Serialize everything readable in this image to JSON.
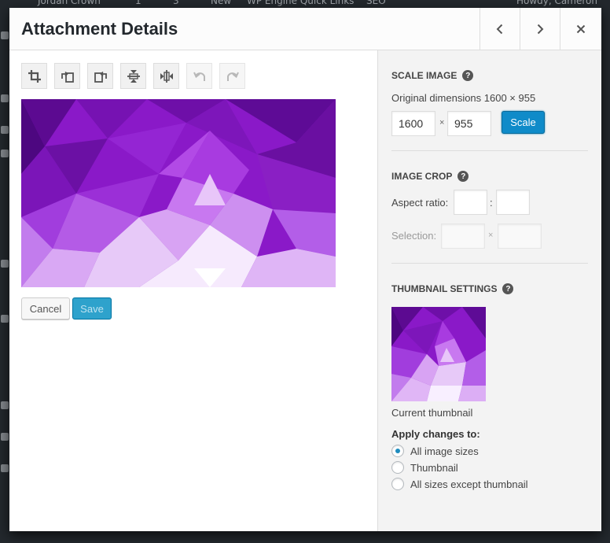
{
  "adminbar": {
    "site": "Jordan Crown",
    "updates": "1",
    "comments": "3",
    "new": "New",
    "quicklinks": "WP Engine Quick Links",
    "seo": "SEO",
    "howdy": "Howdy, Cameron"
  },
  "modal": {
    "title": "Attachment Details",
    "prev_icon": "chevron-left-icon",
    "next_icon": "chevron-right-icon",
    "close_icon": "close-icon"
  },
  "toolbar": {
    "tools": [
      {
        "name": "crop-tool",
        "icon": "crop-icon",
        "enabled": true
      },
      {
        "name": "rotate-left-tool",
        "icon": "rotate-left-icon",
        "enabled": true
      },
      {
        "name": "rotate-right-tool",
        "icon": "rotate-right-icon",
        "enabled": true
      },
      {
        "name": "flip-vertical-tool",
        "icon": "flip-vertical-icon",
        "enabled": true
      },
      {
        "name": "flip-horizontal-tool",
        "icon": "flip-horizontal-icon",
        "enabled": true
      },
      {
        "name": "undo-tool",
        "icon": "undo-icon",
        "enabled": false
      },
      {
        "name": "redo-tool",
        "icon": "redo-icon",
        "enabled": false
      }
    ]
  },
  "actions": {
    "cancel_label": "Cancel",
    "save_label": "Save"
  },
  "scale": {
    "title": "SCALE IMAGE",
    "original": "Original dimensions 1600 × 955",
    "width": "1600",
    "height": "955",
    "times": "×",
    "button": "Scale"
  },
  "crop": {
    "title": "IMAGE CROP",
    "aspect_label": "Aspect ratio:",
    "aspect_sep": ":",
    "aspect_w": "",
    "aspect_h": "",
    "selection_label": "Selection:",
    "selection_sep": "×",
    "selection_w": "",
    "selection_h": ""
  },
  "thumbnail": {
    "title": "THUMBNAIL SETTINGS",
    "caption": "Current thumbnail",
    "apply_label": "Apply changes to:",
    "options": [
      {
        "label": "All image sizes",
        "checked": true
      },
      {
        "label": "Thumbnail",
        "checked": false
      },
      {
        "label": "All sizes except thumbnail",
        "checked": false
      }
    ]
  },
  "colors": {
    "accent": "#1e8cbe",
    "scale_button": "#0f8bc9",
    "save_button": "#2ea2cc",
    "image_purple": "#8a19c8"
  }
}
